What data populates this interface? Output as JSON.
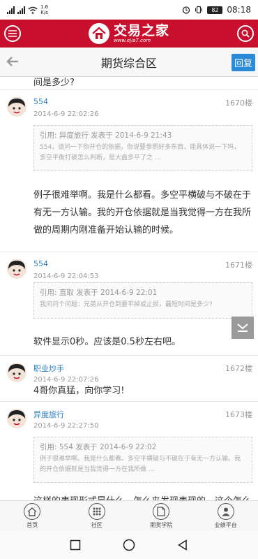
{
  "status": {
    "netspeed_value": "1.6",
    "netspeed_unit": "K/s",
    "battery": "82",
    "time": "08:18"
  },
  "brand": {
    "name": "交易之家",
    "url": "www.ejia7.com"
  },
  "header": {
    "title": "期货综合区",
    "reply_label": "回复"
  },
  "fragment_text": "间是多少?",
  "posts": [
    {
      "user": "554",
      "floor": "1670楼",
      "time": "2014-6-9 22:02:26",
      "quote_head": "引用: 异度旅行 发表于 2014-6-9 21:43",
      "quote_body": "554，请问一下你开仓的依据，你说要参照好多东西，能具体说一下吗，多空平衡打破怎么判断，是大盘多平了之 ...",
      "body": "例子很难举啊。我是什么都看。多空平横破与不破在于有无一方认输。我的开仓依据就是当我觉得一方在我所做的周期内刚准备开始认输的时候。"
    },
    {
      "user": "554",
      "floor": "1671楼",
      "time": "2014-6-9 22:04:53",
      "quote_head": "引用: 直取 发表于 2014-6-9 22:01",
      "quote_body": "我问问个问题：兄弟从开仓到要平掉或止损，最短时间是多少?",
      "body": "软件显示0秒。应该是0.5秒左右吧。"
    },
    {
      "user": "职业炒手",
      "floor": "1672楼",
      "time": "2014-6-9 22:07:26",
      "body": "4哥你真猛，向你学习!"
    },
    {
      "user": "异度旅行",
      "floor": "1673楼",
      "time": "2014-6-9 22:27:50",
      "quote_head": "引用: 554 发表于 2014-6-9 22:02",
      "quote_body": "例子很难举啊。我是什么都看。多空平横破与不破在于有无一方认输。我的开仓依据就是当我觉得一方在我所做 ...",
      "body": "这样的表现形式是什么，怎么来发现表现的，这个怎么..."
    }
  ],
  "tabs": [
    {
      "label": "首页",
      "icon": "home-icon"
    },
    {
      "label": "社区",
      "icon": "community-icon"
    },
    {
      "label": "期货学院",
      "icon": "document-icon"
    },
    {
      "label": "业绩平台",
      "icon": "user-icon"
    }
  ],
  "colors": {
    "brand_red": "#c8102e",
    "reply_blue": "#2b8ad8",
    "username_blue": "#2a7fc1"
  }
}
